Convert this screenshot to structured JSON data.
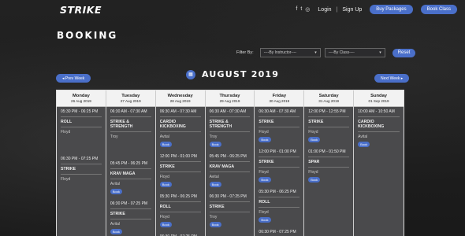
{
  "header": {
    "logo": "STRIKE",
    "social": [
      "f",
      "t",
      "ig"
    ],
    "login": "Login",
    "separator": "|",
    "signup": "Sign Up",
    "buy_packages": "Buy Packages",
    "book_class": "Book Class"
  },
  "page": {
    "title": "BOOKING",
    "filter_label": "Filter By:",
    "instructor_select": "----By Instructor----",
    "class_select": "----By Class----",
    "reset": "Reset",
    "prev_week": "Prev Week",
    "next_week": "Next Week",
    "month": "AUGUST 2019"
  },
  "colors": {
    "accent": "#4a6fc9",
    "calendar_bg": "#4a4a4c"
  },
  "days": [
    {
      "name": "Monday",
      "date": "26 Aug 2019",
      "sessions": [
        {
          "time": "05:30 PM - 06:25 PM",
          "class": "ROLL",
          "instructor": "Floyd",
          "book": ""
        },
        {
          "time": "06:30 PM - 07:25 PM",
          "class": "STRIKE",
          "instructor": "Floyd",
          "book": ""
        }
      ]
    },
    {
      "name": "Tuesday",
      "date": "27 Aug 2019",
      "sessions": [
        {
          "time": "06:30 AM - 07:30 AM",
          "class": "STRIKE & STRENGTH",
          "instructor": "Troy",
          "book": ""
        },
        {
          "time": "05:45 PM - 06:25 PM",
          "class": "KRAV MAGA",
          "instructor": "Avital",
          "book": "Book"
        },
        {
          "time": "06:30 PM - 07:25 PM",
          "class": "STRIKE",
          "instructor": "Avital",
          "book": "Book"
        }
      ]
    },
    {
      "name": "Wednesday",
      "date": "28 Aug 2019",
      "sessions": [
        {
          "time": "06:30 AM - 07:30 AM",
          "class": "CARDIO KICKBOXING",
          "instructor": "Avital",
          "book": "Book"
        },
        {
          "time": "12:00 PM - 01:00 PM",
          "class": "STRIKE",
          "instructor": "Floyd",
          "book": "Book"
        },
        {
          "time": "05:30 PM - 06:25 PM",
          "class": "ROLL",
          "instructor": "Floyd",
          "book": "Book"
        },
        {
          "time": "06:30 PM - 07:25 PM",
          "class": "",
          "instructor": "",
          "book": ""
        }
      ]
    },
    {
      "name": "Thursday",
      "date": "29 Aug 2019",
      "sessions": [
        {
          "time": "06:30 AM - 07:30 AM",
          "class": "STRIKE & STRENGTH",
          "instructor": "Troy",
          "book": "Book"
        },
        {
          "time": "05:45 PM - 06:25 PM",
          "class": "KRAV MAGA",
          "instructor": "Avital",
          "book": "Book"
        },
        {
          "time": "06:30 PM - 07:25 PM",
          "class": "STRIKE",
          "instructor": "Troy",
          "book": "Book"
        }
      ]
    },
    {
      "name": "Friday",
      "date": "30 Aug 2019",
      "sessions": [
        {
          "time": "06:30 AM - 07:30 AM",
          "class": "STRIKE",
          "instructor": "Floyd",
          "book": "Book"
        },
        {
          "time": "12:00 PM - 01:00 PM",
          "class": "STRIKE",
          "instructor": "Floyd",
          "book": "Book"
        },
        {
          "time": "05:30 PM - 06:25 PM",
          "class": "ROLL",
          "instructor": "Floyd",
          "book": "Book"
        },
        {
          "time": "06:30 PM - 07:25 PM",
          "class": "",
          "instructor": "",
          "book": ""
        }
      ]
    },
    {
      "name": "Saturday",
      "date": "31 Aug 2019",
      "sessions": [
        {
          "time": "12:00 PM - 12:55 PM",
          "class": "STRIKE",
          "instructor": "Floyd",
          "book": "Book"
        },
        {
          "time": "01:00 PM - 01:50 PM",
          "class": "SPAR",
          "instructor": "Floyd",
          "book": "Book"
        }
      ]
    },
    {
      "name": "Sunday",
      "date": "01 Sep 2019",
      "sessions": [
        {
          "time": "10:00 AM - 10:50 AM",
          "class": "CARDIO KICKBOXING",
          "instructor": "Avital",
          "book": "Book"
        }
      ]
    }
  ]
}
